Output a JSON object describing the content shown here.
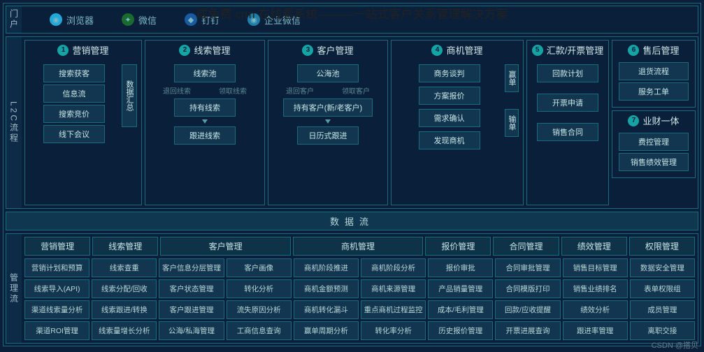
{
  "title": "成免费 crm 在线看系统———一站式客户关系管理解决方案",
  "watermark": "CSDN @搭贝",
  "portal": {
    "label": "门户",
    "items": [
      {
        "icon": "browser",
        "label": "浏览器"
      },
      {
        "icon": "wechat",
        "label": "微信"
      },
      {
        "icon": "ding",
        "label": "钉钉"
      },
      {
        "icon": "work",
        "label": "企业微信"
      }
    ]
  },
  "l2c": {
    "label": "L2C流程",
    "cols": [
      {
        "num": "1",
        "title": "营销管理",
        "summary": "数据汇总",
        "items": [
          "搜索获客",
          "信息流",
          "搜索竞价",
          "线下会议"
        ]
      },
      {
        "num": "2",
        "title": "线索管理",
        "annot": [
          "退回线索",
          "领取线索"
        ],
        "items": [
          "线索池",
          "持有线索",
          "跟进线索"
        ]
      },
      {
        "num": "3",
        "title": "客户管理",
        "annot": [
          "退回客户",
          "领取客户"
        ],
        "items": [
          "公海池",
          "持有客户(新/老客户)",
          "日历式跟进"
        ]
      },
      {
        "num": "4",
        "title": "商机管理",
        "win": "赢单",
        "lose": "输单",
        "items": [
          "商务谈判",
          "方案报价",
          "需求确认",
          "发现商机"
        ]
      },
      {
        "num": "5",
        "title": "汇款/开票管理",
        "items": [
          "回款计划",
          "开票申请",
          "销售合同"
        ]
      },
      {
        "num": "6",
        "title": "售后管理",
        "items": [
          "退货流程",
          "服务工单"
        ]
      },
      {
        "num": "7",
        "title": "业财一体",
        "items": [
          "费控管理",
          "销售绩效管理"
        ]
      }
    ]
  },
  "dataflow": "数据流",
  "mgmt": {
    "label": "管理流",
    "heads": [
      "营销管理",
      "线索管理",
      "客户管理",
      "商机管理",
      "报价管理",
      "合同管理",
      "绩效管理",
      "权限管理"
    ],
    "rows": [
      [
        "营销计划和预算",
        "线索查重",
        "客户信息分层管理",
        "客户画像",
        "商机阶段推进",
        "商机阶段分析",
        "报价审批",
        "合同审批管理",
        "销售目标管理",
        "数据安全管理"
      ],
      [
        "线索导入(API)",
        "线索分配/回收",
        "客户状态管理",
        "转化分析",
        "商机金额预测",
        "商机来源管理",
        "产品销量管理",
        "合同模版打印",
        "销售业绩排名",
        "表单权限组"
      ],
      [
        "渠道线索量分析",
        "线索跟进/转换",
        "客户跟进管理",
        "流失原因分析",
        "商机转化漏斗",
        "重点商机过程监控",
        "成本/毛利管理",
        "回款/应收提醒",
        "绩效分析",
        "成员管理"
      ],
      [
        "渠道ROI管理",
        "线索量增长分析",
        "公海/私海管理",
        "工商信息查询",
        "赢单周期分析",
        "转化率分析",
        "历史报价管理",
        "开票进展查询",
        "跟进率管理",
        "离职交接"
      ]
    ]
  }
}
